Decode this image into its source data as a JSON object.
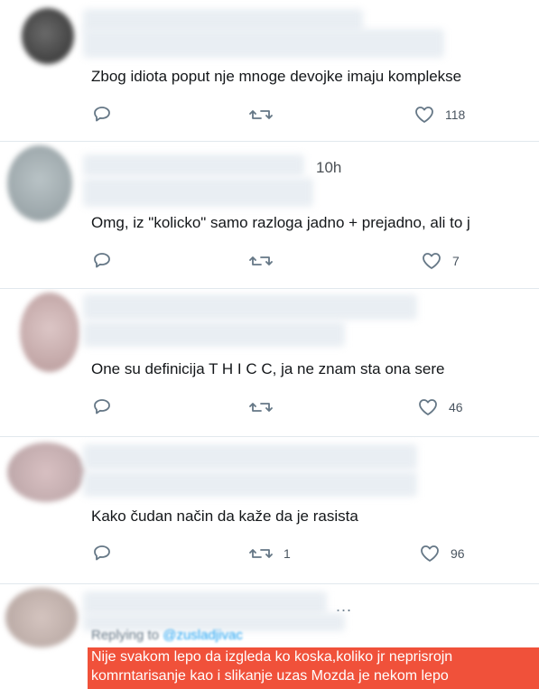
{
  "tweets": [
    {
      "text": "Zbog idiota poput nje mnoge devojke imaju komplekse",
      "likes": "118",
      "retweets": ""
    },
    {
      "time": "10h",
      "text": "Omg, iz \"kolicko\" samo razloga jadno + prejadno, ali to j",
      "likes": "7",
      "retweets": ""
    },
    {
      "text": "One su definicija T H I C C, ja ne znam sta ona sere",
      "likes": "46",
      "retweets": ""
    },
    {
      "text": "Kako čudan način da kaže da je rasista",
      "likes": "96",
      "retweets": "1"
    },
    {
      "more": "...",
      "replying": "Replying to",
      "replying_handle": "@zusladjivac",
      "text_line1": "Nije svakom lepo da izgleda ko koska,koliko jr neprisrojn",
      "text_line2": "komrntarisanje kao i slikanje uzas Mozda je nekom lepo"
    }
  ],
  "icons": {
    "reply": "reply-icon",
    "retweet": "retweet-icon",
    "like": "heart-icon",
    "more": "more-icon"
  },
  "colors": {
    "highlight": "#f0513a",
    "icon": "#657786",
    "link": "#1da1f2"
  }
}
